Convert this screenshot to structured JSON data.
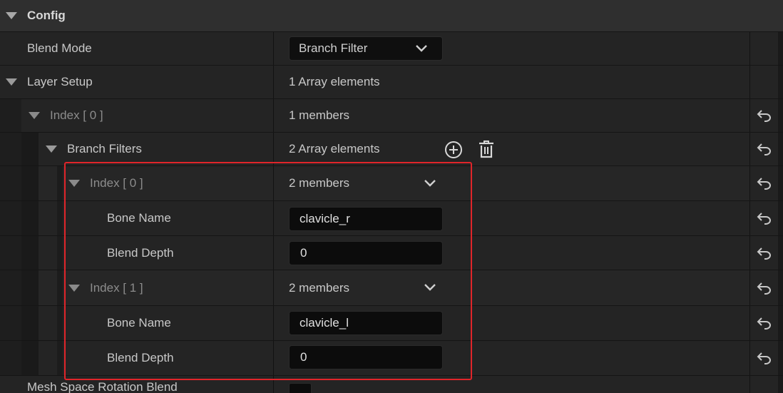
{
  "sections": {
    "config": {
      "label": "Config"
    }
  },
  "rows": {
    "blend_mode": {
      "label": "Blend Mode",
      "value": "Branch Filter"
    },
    "layer_setup": {
      "label": "Layer Setup",
      "value": "1 Array elements"
    },
    "layer_index0": {
      "label": "Index [ 0 ]",
      "value": "1 members"
    },
    "branch_filters": {
      "label": "Branch Filters",
      "value": "2 Array elements"
    },
    "bf_index0": {
      "label": "Index [ 0 ]",
      "value": "2 members"
    },
    "bf0_bone_name": {
      "label": "Bone Name",
      "value": "clavicle_r"
    },
    "bf0_blend_depth": {
      "label": "Blend Depth",
      "value": "0"
    },
    "bf_index1": {
      "label": "Index [ 1 ]",
      "value": "2 members"
    },
    "bf1_bone_name": {
      "label": "Bone Name",
      "value": "clavicle_l"
    },
    "bf1_blend_depth": {
      "label": "Blend Depth",
      "value": "0"
    },
    "mesh_space": {
      "label": "Mesh Space Rotation Blend"
    }
  },
  "icons": {
    "expand": "triangle-down-icon",
    "dropdown": "chevron-down-icon",
    "add": "add-circle-icon",
    "delete": "trash-icon",
    "reset": "reset-to-default-icon"
  },
  "colors": {
    "highlight": "#e0252a",
    "row_bg": "#242424",
    "header_bg": "#2f2f2f",
    "input_bg": "#0c0c0c"
  }
}
